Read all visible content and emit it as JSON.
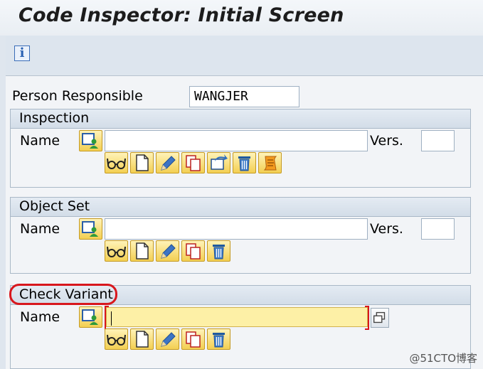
{
  "header": {
    "title": "Code Inspector: Initial Screen"
  },
  "toolbar": {
    "info_icon_glyph": "i"
  },
  "person_responsible": {
    "label": "Person Responsible",
    "value": "WANGJER"
  },
  "inspection": {
    "title": "Inspection",
    "name_label": "Name",
    "name_value": "",
    "version_label": "Vers.",
    "version_value": "",
    "actions": [
      "display-glasses-icon",
      "create-document-icon",
      "change-pencil-icon",
      "copy-icon",
      "rename-icon",
      "delete-trash-icon",
      "results-scroll-icon"
    ]
  },
  "object_set": {
    "title": "Object Set",
    "name_label": "Name",
    "name_value": "",
    "version_label": "Vers.",
    "version_value": "",
    "actions": [
      "display-glasses-icon",
      "create-document-icon",
      "change-pencil-icon",
      "copy-icon",
      "delete-trash-icon"
    ]
  },
  "check_variant": {
    "title": "Check Variant",
    "name_label": "Name",
    "name_value": "",
    "actions": [
      "display-glasses-icon",
      "create-document-icon",
      "change-pencil-icon",
      "copy-icon",
      "delete-trash-icon"
    ]
  },
  "colors": {
    "highlight": "#d8171d",
    "button_yellow": "#f3cf52",
    "required_field": "#fdf0a6"
  },
  "watermark": "@51CTO博客"
}
